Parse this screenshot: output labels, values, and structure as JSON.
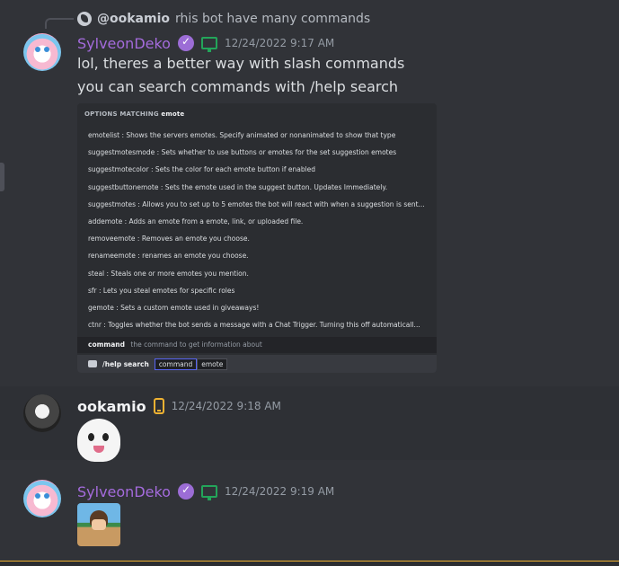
{
  "reply": {
    "user": "@ookamio",
    "text": "rhis bot have many commands"
  },
  "messages": [
    {
      "username": "SylveonDeko",
      "timestamp": "12/24/2022 9:17 AM",
      "lines": [
        "lol, theres a better way with slash commands",
        "you can search commands with /help search"
      ]
    },
    {
      "username": "ookamio",
      "timestamp": "12/24/2022 9:18 AM"
    },
    {
      "username": "SylveonDeko",
      "timestamp": "12/24/2022 9:19 AM"
    }
  ],
  "embed": {
    "title_prefix": "OPTIONS MATCHING",
    "title_query": "emote",
    "options": [
      "emotelist : Shows the servers emotes. Specify animated or nonanimated to show that type",
      "suggestmotesmode : Sets whether to use buttons or emotes for the set suggestion emotes",
      "suggestmotecolor : Sets the color for each emote button if enabled",
      "suggestbuttonemote : Sets the emote used in the suggest button. Updates Immediately.",
      "suggestmotes : Allows you to set up to 5 emotes the bot will react with when a suggestion is sent...",
      "addemote : Adds an emote from a emote, link, or uploaded file.",
      "removeemote : Removes an emote you choose.",
      "renameemote : renames an emote you choose.",
      "steal : Steals one or more emotes you mention.",
      "sfr : Lets you steal emotes for specific roles",
      "gemote : Sets a custom emote used in giveaways!",
      "ctnr : Toggles whether the bot sends a message with a Chat Trigger. Turning this off automaticall..."
    ],
    "hint_name": "command",
    "hint_desc": "the command to get information about",
    "command_text": "/help search",
    "chip_param": "command",
    "chip_value": "emote"
  },
  "colors": {
    "background": "#313338",
    "username_purple": "#a46bdc",
    "desktop_status": "#23a55a",
    "mobile_status": "#f0b232"
  }
}
